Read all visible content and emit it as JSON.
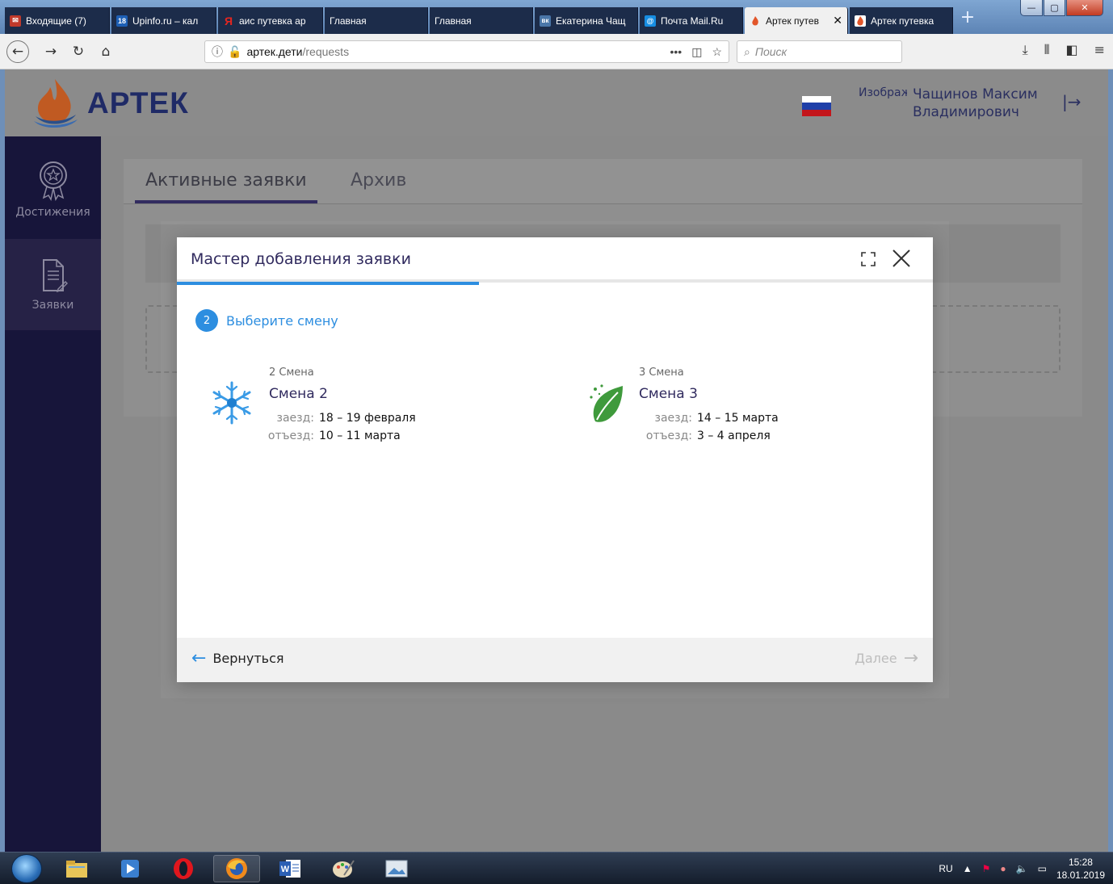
{
  "browser": {
    "tabs": [
      {
        "label": "Входящие (7)",
        "color": "#c0392b",
        "icon": "mail-icon"
      },
      {
        "label": "Upinfo.ru – кал",
        "color": "#1d5fb5",
        "icon": "calendar-icon",
        "badge": "18"
      },
      {
        "label": "аис путевка ар",
        "color": "#e52620",
        "icon": "yandex-icon",
        "badge": "Я"
      },
      {
        "label": "Главная",
        "color": "",
        "icon": ""
      },
      {
        "label": "Главная",
        "color": "",
        "icon": ""
      },
      {
        "label": "Екатерина Чащ",
        "color": "#4a76a8",
        "icon": "vk-icon",
        "badge": "вк"
      },
      {
        "label": "Почта Mail.Ru",
        "color": "#168de2",
        "icon": "mailru-icon",
        "badge": "@"
      },
      {
        "label": "Артек путев",
        "color": "#e2562a",
        "icon": "artek-icon",
        "active": true
      },
      {
        "label": "Артек путевка",
        "color": "#e2562a",
        "icon": "artek-icon"
      }
    ],
    "url_host": "артек.дети",
    "url_path": "/requests",
    "search_placeholder": "Поиск"
  },
  "site": {
    "logo_text": "АРТЕК",
    "user_hint": "Изображение пользователя",
    "user_name_line1": "Чащинов Максим",
    "user_name_line2": "Владимирович",
    "sidebar": [
      {
        "label": "Достижения",
        "icon": "medal-icon",
        "active": false
      },
      {
        "label": "Заявки",
        "icon": "document-icon",
        "active": true
      }
    ],
    "tabs": [
      {
        "label": "Активные заявки",
        "active": true
      },
      {
        "label": "Архив",
        "active": false
      }
    ]
  },
  "modal": {
    "title": "Мастер добавления заявки",
    "progress_fraction": 0.4,
    "step_number": "2",
    "step_label": "Выберите смену",
    "shifts": [
      {
        "small": "2 Смена",
        "name": "Смена 2",
        "arrive_label": "заезд:",
        "arrive": "18 – 19 февраля",
        "depart_label": "отъезд:",
        "depart": "10 – 11 марта",
        "icon": "snowflake-icon"
      },
      {
        "small": "3 Смена",
        "name": "Смена 3",
        "arrive_label": "заезд:",
        "arrive": "14 – 15 марта",
        "depart_label": "отъезд:",
        "depart": "3 – 4 апреля",
        "icon": "leaf-icon"
      }
    ],
    "back_label": "Вернуться",
    "next_label": "Далее"
  },
  "taskbar": {
    "lang": "RU",
    "time": "15:28",
    "date": "18.01.2019"
  },
  "colors": {
    "accent": "#2d8ee0",
    "brand_dark": "#302a5e",
    "sidebar": "#17153a"
  }
}
